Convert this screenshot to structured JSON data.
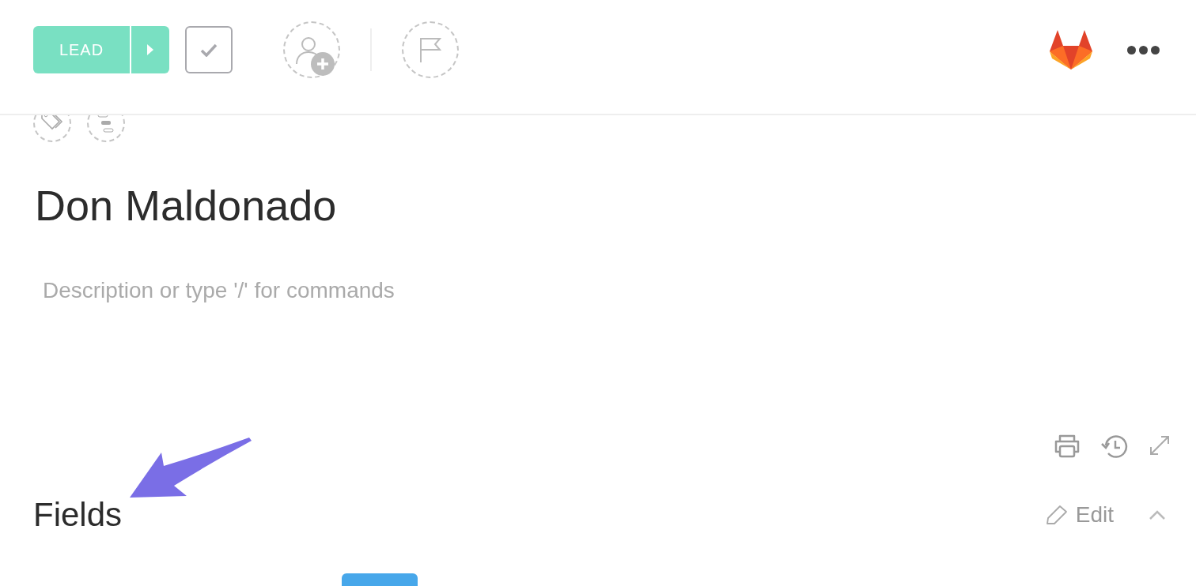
{
  "status_button": {
    "label": "LEAD",
    "color": "#79e0c2"
  },
  "title": "Don Maldonado",
  "description": {
    "placeholder": "Description or type '/' for commands"
  },
  "fields_section": {
    "title": "Fields",
    "edit_label": "Edit",
    "expanded": true
  }
}
